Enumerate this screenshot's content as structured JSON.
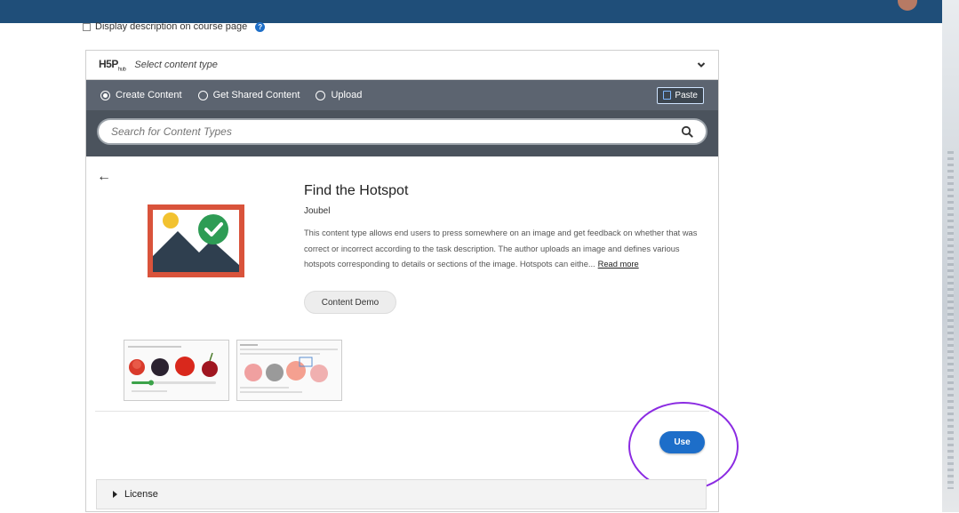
{
  "header": {
    "display_description_label": "Display description on course page",
    "display_description_checked": false
  },
  "selector": {
    "logo_text": "H5P",
    "logo_suffix": "hub",
    "select_label": "Select content type"
  },
  "tabs": [
    {
      "label": "Create Content",
      "selected": true
    },
    {
      "label": "Get Shared Content",
      "selected": false
    },
    {
      "label": "Upload",
      "selected": false
    }
  ],
  "paste_label": "Paste",
  "search": {
    "placeholder": "Search for Content Types"
  },
  "content_type": {
    "title": "Find the Hotspot",
    "author": "Joubel",
    "description": "This content type allows end users to press somewhere on an image and get feedback on whether that was correct or incorrect according to the task description. The author uploads an image and defines various hotspots corresponding to details or sections of the image. Hotspots can eithe...",
    "read_more": "Read more",
    "demo_label": "Content Demo",
    "use_label": "Use"
  },
  "license_label": "License",
  "colors": {
    "top_bar": "#1f4e79",
    "tab_bar": "#5c6470",
    "use_button": "#1d6ec9",
    "highlight": "#8b2be2",
    "image_border": "#d9533b"
  }
}
